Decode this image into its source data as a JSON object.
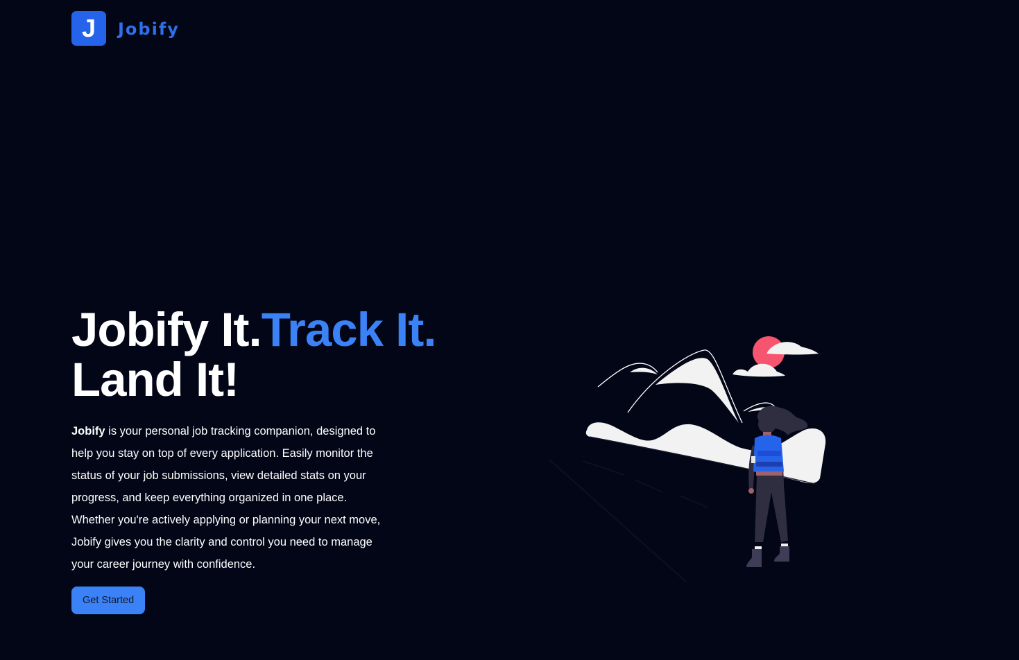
{
  "navbar": {
    "logo_letter": "J",
    "brand_name": "Jobify"
  },
  "hero": {
    "headline_part1": "Jobify It.",
    "headline_part2": "Track It.",
    "headline_part3": "Land It!",
    "description_brand": "Jobify",
    "description_text": " is your personal job tracking companion, designed to help you stay on top of every application. Easily monitor the status of your job submissions, view detailed stats on your progress, and keep everything organized in one place. Whether you're actively applying or planning your next move, Jobify gives you the clarity and control you need to manage your career journey with confidence.",
    "cta_label": "Get Started"
  },
  "illustration": {
    "icon": "hiker-mountains-illustration"
  },
  "colors": {
    "background": "#020617",
    "brand": "#2563eb",
    "accent": "#3b82f6",
    "text": "#ffffff",
    "sun": "#f7546f"
  }
}
